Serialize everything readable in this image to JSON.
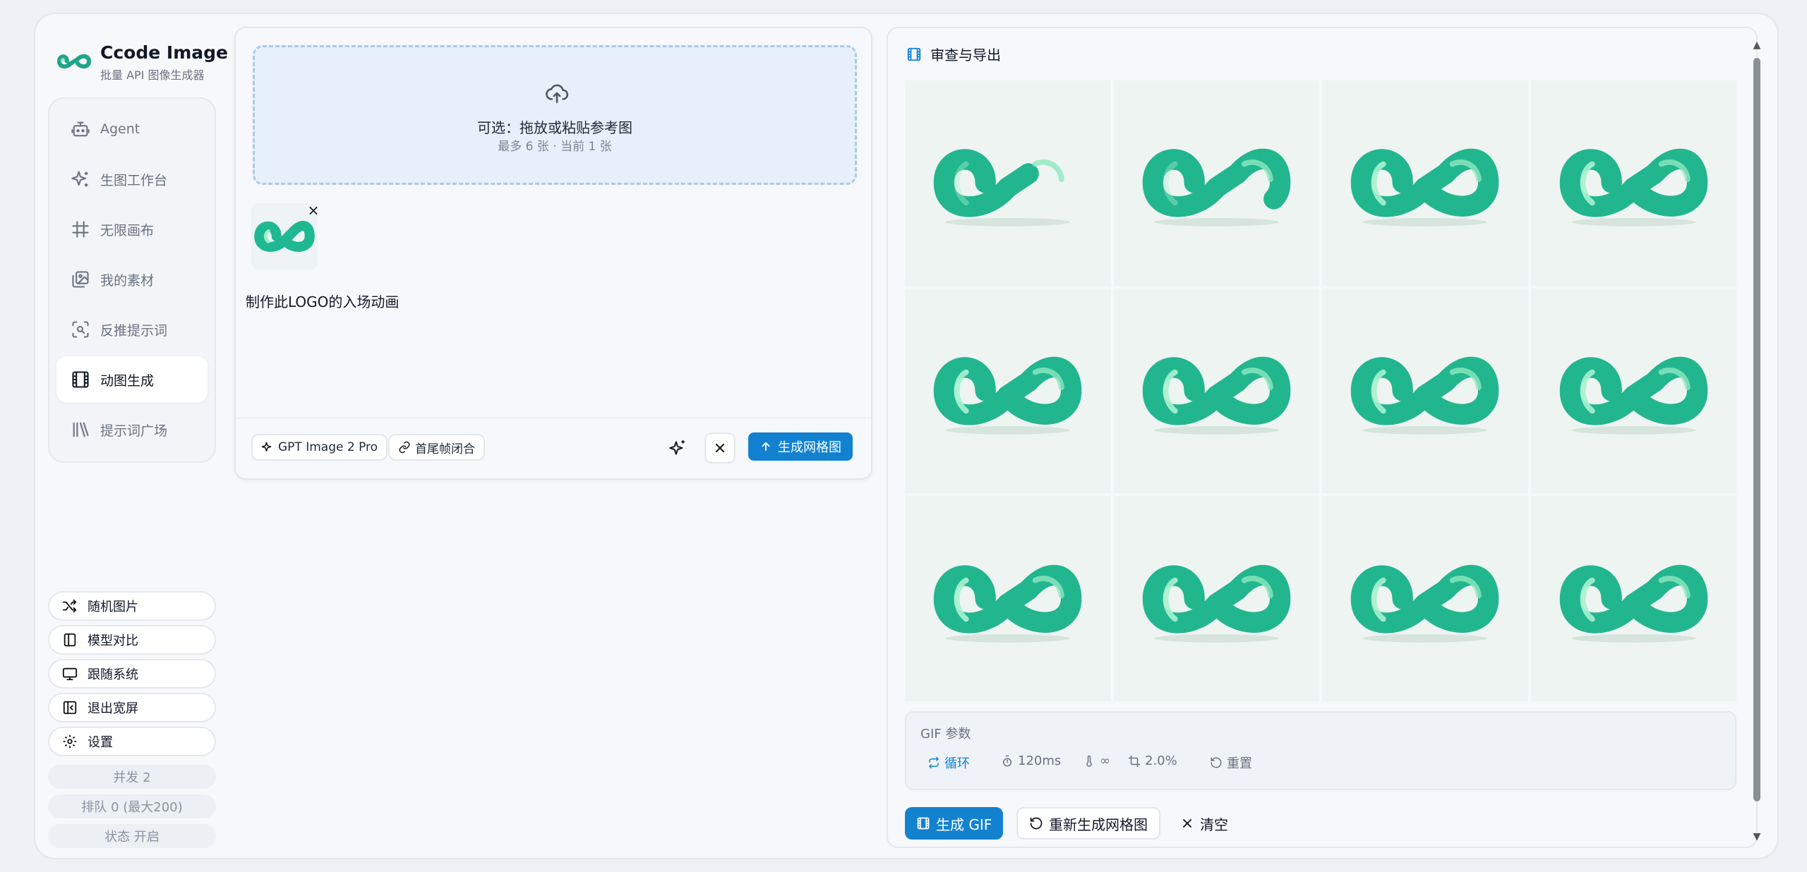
{
  "brand": {
    "title": "Ccode Image",
    "subtitle": "批量 API 图像生成器"
  },
  "colors": {
    "accent": "#1282d0",
    "logo_light": "#7ee8b5",
    "logo_dark": "#12a88a"
  },
  "nav": {
    "items": [
      {
        "label": "Agent",
        "icon": "robot-icon"
      },
      {
        "label": "生图工作台",
        "icon": "sparkles-icon"
      },
      {
        "label": "无限画布",
        "icon": "hash-grid-icon"
      },
      {
        "label": "我的素材",
        "icon": "images-icon"
      },
      {
        "label": "反推提示词",
        "icon": "scan-search-icon"
      },
      {
        "label": "动图生成",
        "icon": "film-icon",
        "active": true
      },
      {
        "label": "提示词广场",
        "icon": "library-icon"
      }
    ]
  },
  "side_actions": {
    "random": "随机图片",
    "compare": "模型对比",
    "theme": "跟随系统",
    "fullscreen": "退出宽屏",
    "settings": "设置"
  },
  "stats": {
    "concurrency": "并发 2",
    "queue": "排队 0 (最大200)",
    "status": "状态 开启"
  },
  "upload": {
    "title": "可选：拖放或粘贴参考图",
    "subtitle": "最多 6 张 · 当前 1 张",
    "remove": "×"
  },
  "prompt": {
    "value": "制作此LOGO的入场动画"
  },
  "composer": {
    "model": "GPT Image 2 Pro",
    "loop_mode": "首尾帧闭合",
    "generate": "生成网格图"
  },
  "review": {
    "title": "审查与导出",
    "frame_count": 12,
    "frames_progress": [
      0.55,
      0.8,
      1,
      1,
      1,
      1,
      1,
      1,
      1,
      1,
      1,
      1
    ]
  },
  "gif": {
    "label": "GIF 参数",
    "loop": "循环",
    "delay": "120ms",
    "repeat": "∞",
    "crop": "2.0%",
    "reset": "重置"
  },
  "actions": {
    "make_gif": "生成 GIF",
    "regenerate": "重新生成网格图",
    "clear": "清空"
  }
}
